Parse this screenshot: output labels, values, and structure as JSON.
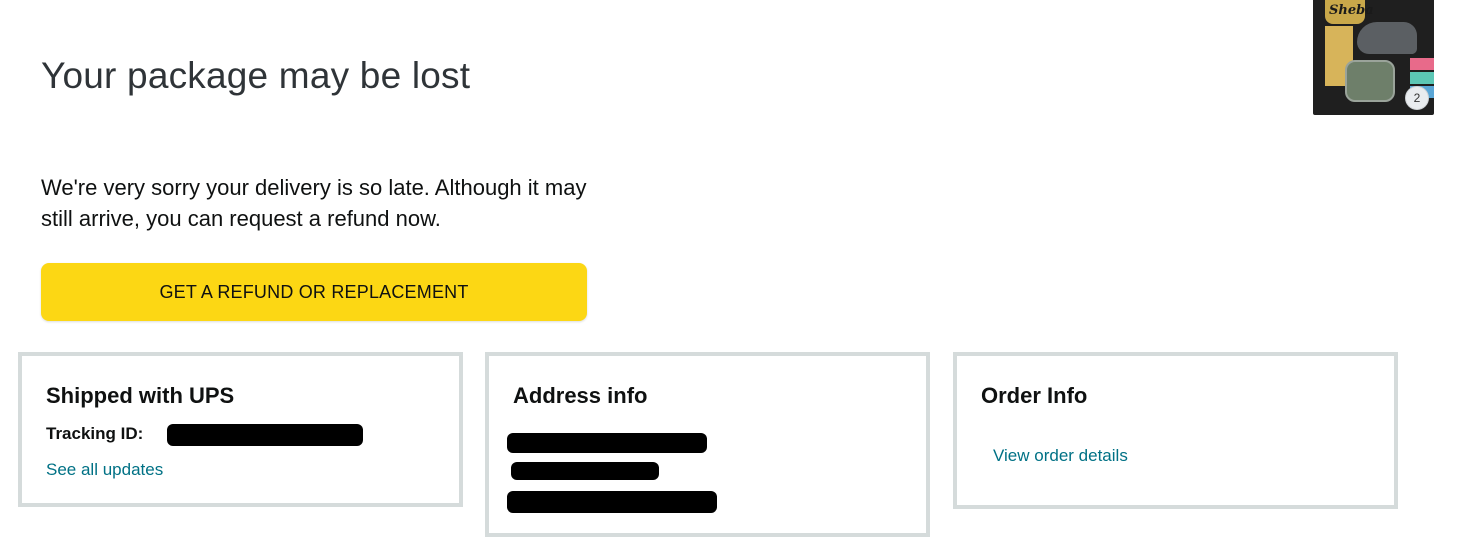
{
  "header": {
    "title": "Your package may be lost"
  },
  "product_thumbnail": {
    "brand_text": "Sheba",
    "quantity_badge": "2"
  },
  "message": {
    "text": "We're very sorry your delivery is so late. Although it may still arrive, you can request a refund now."
  },
  "actions": {
    "refund_button_label": "GET A REFUND OR REPLACEMENT"
  },
  "cards": {
    "shipped": {
      "title": "Shipped with UPS",
      "tracking_label": "Tracking ID:",
      "see_updates_link": "See all updates"
    },
    "address": {
      "title": "Address info"
    },
    "order": {
      "title": "Order Info",
      "view_order_link": "View order details"
    }
  },
  "colors": {
    "button_yellow": "#fcd714",
    "link_teal": "#007185",
    "card_border": "#d5dbdb",
    "text_dark": "#0f1111"
  }
}
